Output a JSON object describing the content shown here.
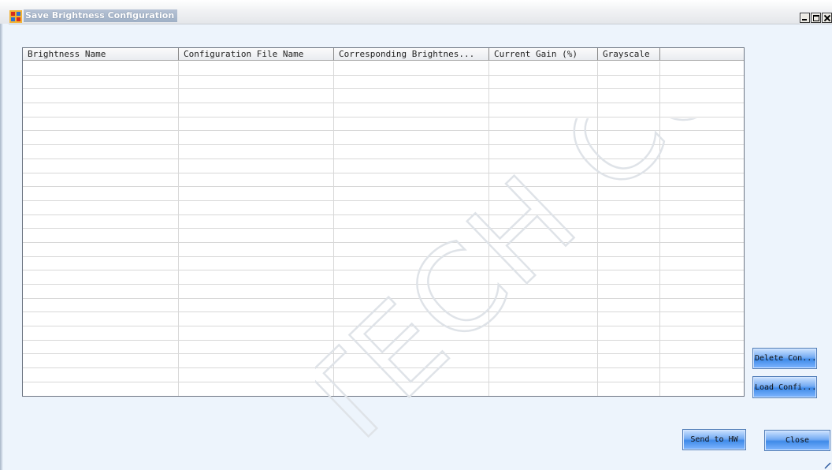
{
  "window": {
    "title": "Save Brightness Configuration"
  },
  "table": {
    "columns": [
      "Brightness Name",
      "Configuration File Name",
      "Corresponding Brightnes...",
      "Current Gain (%)",
      "Grayscale",
      ""
    ],
    "row_count": 24
  },
  "watermark": {
    "text": "TECH CO., LTD"
  },
  "buttons": {
    "delete_config": "Delete Con...",
    "load_config": "Load Confi...",
    "send_to_hw": "Send to HW",
    "close": "Close"
  },
  "colors": {
    "background": "#edf4fc",
    "button_blue": "#5d9cf0"
  }
}
